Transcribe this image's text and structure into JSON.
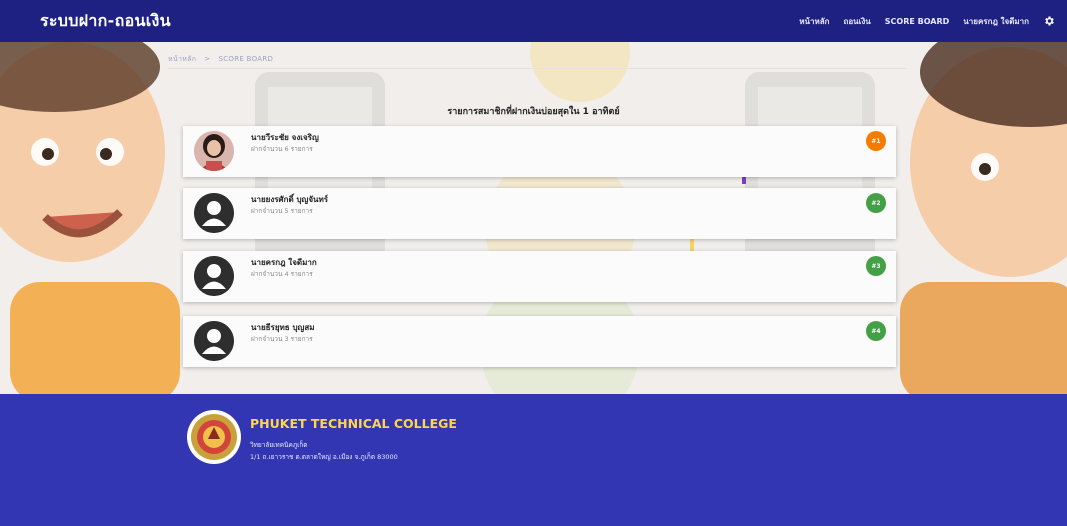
{
  "navbar": {
    "brand": "ระบบฝาก-ถอนเงิน",
    "links": [
      {
        "label": "หน้าหลัก"
      },
      {
        "label": "ถอนเงิน"
      },
      {
        "label": "SCORE BOARD"
      },
      {
        "label": "นายครกฎ ใจดีมาก"
      }
    ]
  },
  "breadcrumb": {
    "home": "หน้าหลัก",
    "separator": ">",
    "current": "SCORE BOARD"
  },
  "scoreboard": {
    "title": "รายการสมาชิกที่ฝากเงินบ่อยสุดใน 1 อาทิตย์",
    "entries": [
      {
        "name": "นายวีระชัย จงเจริญ",
        "count": "ฝากจำนวน 6 รายการ",
        "rank": "#1",
        "color": "#f57c00",
        "avatar": "photo"
      },
      {
        "name": "นายยงรศักดิ์ บุญจันทร์",
        "count": "ฝากจำนวน 5 รายการ",
        "rank": "#2",
        "color": "#43a047",
        "avatar": "default-user"
      },
      {
        "name": "นายครกฎ ใจดีมาก",
        "count": "ฝากจำนวน 4 รายการ",
        "rank": "#3",
        "color": "#43a047",
        "avatar": "default-user"
      },
      {
        "name": "นายธีรยุทธ บุญสม",
        "count": "ฝากจำนวน 3 รายการ",
        "rank": "#4",
        "color": "#43a047",
        "avatar": "default-user"
      }
    ]
  },
  "footer": {
    "college": "PHUKET TECHNICAL COLLEGE",
    "line1": "วิทยาลัยเทคนิคภูเก็ต",
    "line2": "1/1 ถ.เยาวราช ต.ตลาดใหญ่ อ.เมือง จ.ภูเก็ต 83000"
  },
  "colors": {
    "navbar": "#1e2181",
    "footer": "#3236b3",
    "rank_first": "#f57c00",
    "rank_other": "#43a047",
    "college_text": "#ffd54f"
  },
  "icons": [
    "gear-icon",
    "user-icon",
    "college-logo"
  ]
}
